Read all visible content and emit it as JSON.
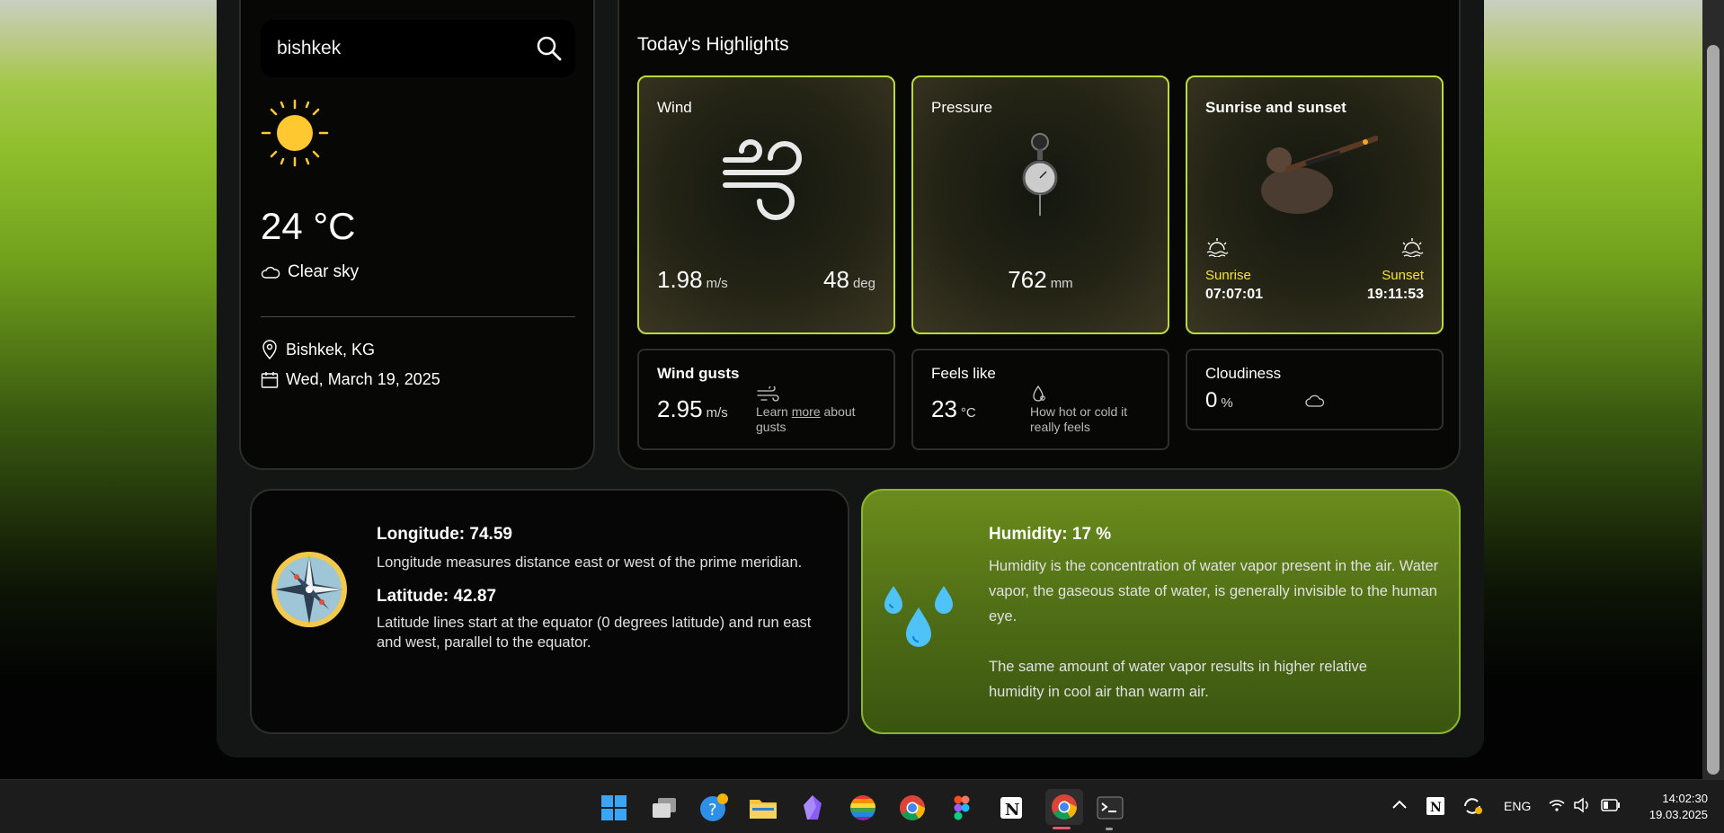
{
  "search": {
    "value": "bishkek"
  },
  "current": {
    "temperature": "24 °C",
    "condition": "Clear sky",
    "location": "Bishkek, KG",
    "date": "Wed, March 19, 2025"
  },
  "highlights": {
    "title": "Today's Highlights",
    "wind": {
      "title": "Wind",
      "speed": "1.98",
      "speed_unit": "m/s",
      "deg": "48",
      "deg_unit": "deg"
    },
    "pressure": {
      "title": "Pressure",
      "value": "762",
      "unit": "mm"
    },
    "sun": {
      "title": "Sunrise and sunset",
      "sunrise_label": "Sunrise",
      "sunrise": "07:07:01",
      "sunset_label": "Sunset",
      "sunset": "19:11:53"
    },
    "gusts": {
      "title": "Wind gusts",
      "value": "2.95",
      "unit": "m/s",
      "note_prefix": "Learn",
      "note_link": "more",
      "note_suffix": "about gusts"
    },
    "feels": {
      "title": "Feels like",
      "value": "23",
      "unit": "°C",
      "note": "How hot or cold it really feels"
    },
    "cloud": {
      "title": "Cloudiness",
      "value": "0",
      "unit": "%"
    }
  },
  "geo": {
    "lon_title": "Longitude: 74.59",
    "lon_text": "Longitude measures distance east or west of the prime meridian.",
    "lat_title": "Latitude: 42.87",
    "lat_text": "Latitude lines start at the equator (0 degrees latitude) and run east and west, parallel to the equator."
  },
  "humidity": {
    "title": "Humidity: 17 %",
    "p1": "Humidity is the concentration of water vapor present in the air. Water vapor, the gaseous state of water, is generally invisible to the human eye.",
    "p2": "The same amount of water vapor results in higher relative humidity in cool air than warm air."
  },
  "taskbar": {
    "lang": "ENG",
    "time": "14:02:30",
    "date": "19.03.2025",
    "apps": [
      "start-icon",
      "task-view-icon",
      "help-icon",
      "file-explorer-icon",
      "obsidian-icon",
      "rainbow-app-icon",
      "chrome-icon",
      "figma-icon",
      "notion-icon",
      "chrome-active-icon",
      "terminal-icon"
    ]
  },
  "colors": {
    "accent": "#b9dc3a",
    "sunrise_text": "#f5e13a",
    "humidity_bg": "#4d6b15"
  }
}
